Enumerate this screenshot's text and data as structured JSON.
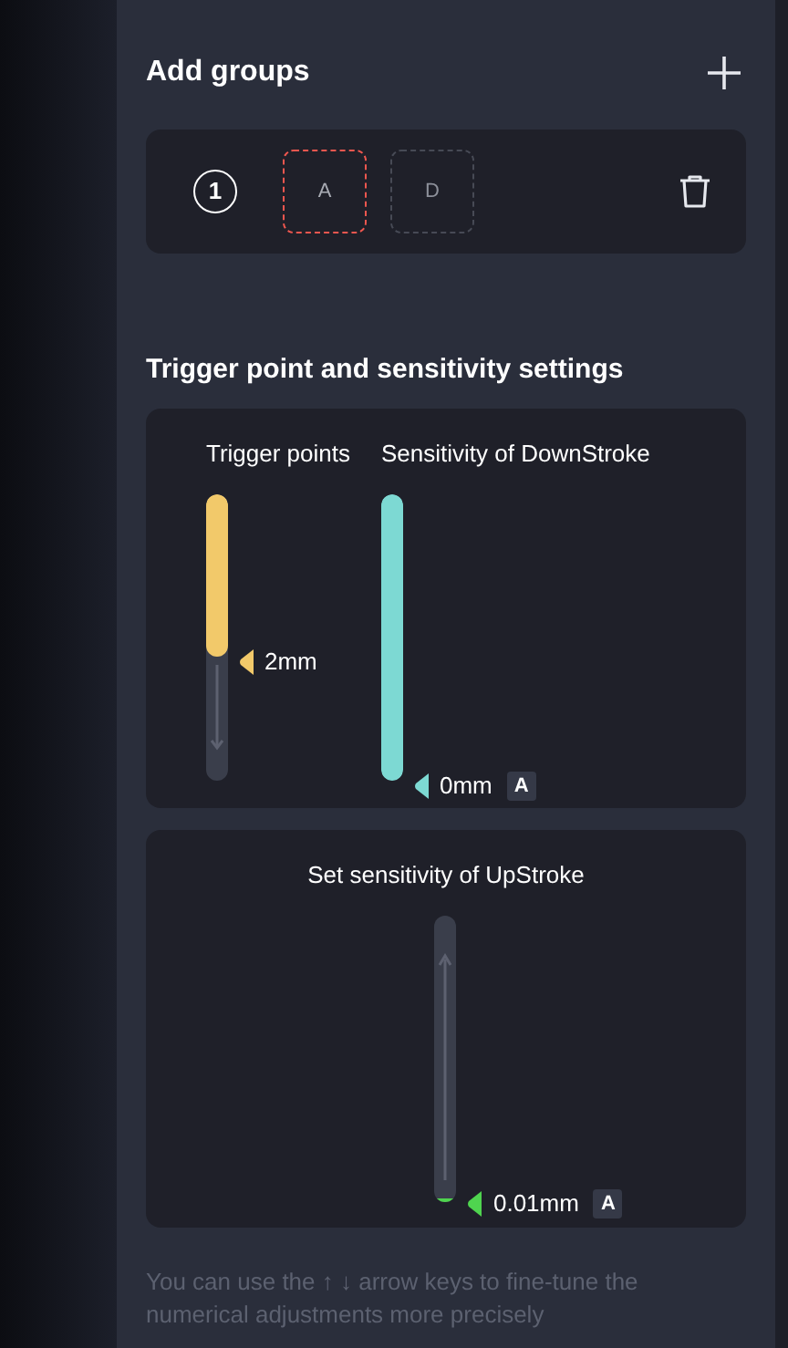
{
  "header": {
    "title": "Add groups"
  },
  "group": {
    "number": "1",
    "keys": [
      {
        "label": "A",
        "selected": true
      },
      {
        "label": "D",
        "selected": false
      }
    ]
  },
  "section_title": "Trigger point and sensitivity settings",
  "cards": [
    {
      "sliders": [
        {
          "label": "Trigger points",
          "level": 0.57,
          "reading": "2mm",
          "color": "#f2c96a",
          "kind": "trigger"
        },
        {
          "label": "Sensitivity of DownStroke",
          "level": 1,
          "reading": "0mm",
          "badge": "A",
          "color": "#7dd9d3",
          "kind": "downstroke"
        }
      ]
    },
    {
      "sliders": [
        {
          "label": "Set sensitivity of UpStroke",
          "level": 0.01,
          "reading": "0.01mm",
          "badge": "A",
          "color": "#4fd44f",
          "kind": "upstroke"
        }
      ]
    }
  ],
  "hint": "You can use the ↑ ↓ arrow keys to fine-tune the numerical adjustments more precisely"
}
